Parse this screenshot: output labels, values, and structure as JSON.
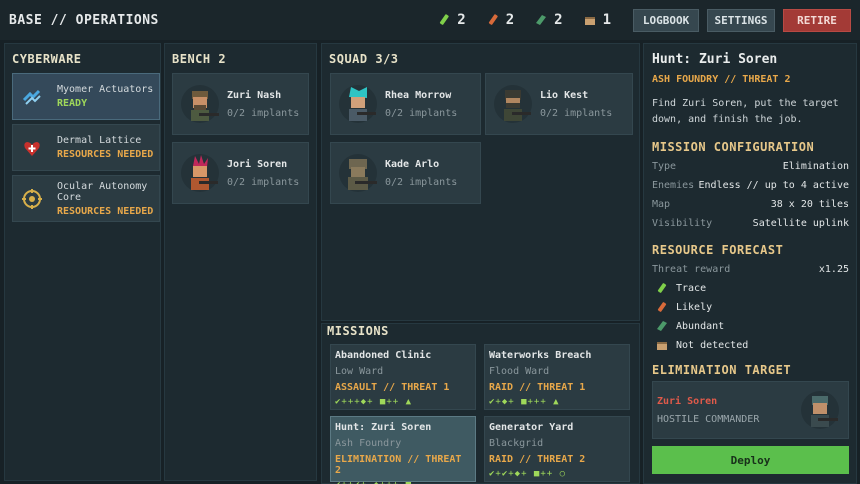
{
  "app": {
    "title": "BASE // OPERATIONS"
  },
  "resources": [
    {
      "icon": "trace-vial-icon",
      "color": "#7fcf4a",
      "count": "2"
    },
    {
      "icon": "likely-vial-icon",
      "color": "#d86a3a",
      "count": "2"
    },
    {
      "icon": "abundant-chip-icon",
      "color": "#4c9a6a",
      "count": "2"
    },
    {
      "icon": "not-detected-crate-icon",
      "color": "#c9a070",
      "count": "1"
    }
  ],
  "toolbar": {
    "logbook": "LOGBOOK",
    "settings": "SETTINGS",
    "retire": "RETIRE"
  },
  "cyberware": {
    "title": "CYBERWARE",
    "items": [
      {
        "name": "Myomer Actuators",
        "status": "READY",
        "state": "ok",
        "icon": "actuator-icon"
      },
      {
        "name": "Dermal Lattice",
        "status": "RESOURCES NEEDED",
        "state": "warn",
        "icon": "heart-plus-icon"
      },
      {
        "name": "Ocular Autonomy Core",
        "status": "RESOURCES NEEDED",
        "state": "warn",
        "icon": "eye-target-icon"
      }
    ]
  },
  "bench": {
    "title": "BENCH  2",
    "crew": [
      {
        "name": "Zuri Nash",
        "implants": "0/2 implants"
      },
      {
        "name": "Jori Soren",
        "implants": "0/2 implants"
      }
    ]
  },
  "squad": {
    "title": "SQUAD  3/3",
    "crew": [
      {
        "name": "Rhea Morrow",
        "implants": "0/2 implants"
      },
      {
        "name": "Lio Kest",
        "implants": "0/2 implants"
      },
      {
        "name": "Kade Arlo",
        "implants": "0/2 implants"
      }
    ]
  },
  "missions": {
    "title": "MISSIONS",
    "items": [
      {
        "name": "Abandoned Clinic",
        "location": "Low Ward",
        "type": "ASSAULT  //  THREAT 1",
        "loot": "✔+++◆+ ■++ ▲"
      },
      {
        "name": "Waterworks Breach",
        "location": "Flood Ward",
        "type": "RAID  //  THREAT 1",
        "loot": "✔+◆+ ■+++ ▲"
      },
      {
        "name": "Hunt: Zuri Soren",
        "location": "Ash Foundry",
        "type": "ELIMINATION  //  THREAT 2",
        "loot": "✔++✔+ ◆+++ ■"
      },
      {
        "name": "Generator Yard",
        "location": "Blackgrid",
        "type": "RAID  //  THREAT 2",
        "loot": "✔+✔+◆+ ■++ ○"
      }
    ]
  },
  "detail": {
    "title": "Hunt: Zuri Soren",
    "subtitle": "ASH FOUNDRY  //  THREAT 2",
    "description": "Find Zuri Soren, put the target down, and finish the job.",
    "config_title": "MISSION CONFIGURATION",
    "config": [
      {
        "k": "Type",
        "v": "Elimination"
      },
      {
        "k": "Enemies",
        "v": "Endless // up to 4 active"
      },
      {
        "k": "Map",
        "v": "38 x 20 tiles"
      },
      {
        "k": "Visibility",
        "v": "Satellite uplink"
      }
    ],
    "forecast_title": "RESOURCE FORECAST",
    "threat_reward_label": "Threat reward",
    "threat_reward_value": "x1.25",
    "legend": [
      "Trace",
      "Likely",
      "Abundant",
      "Not detected"
    ],
    "target_title": "ELIMINATION TARGET",
    "target_name": "Zuri Soren",
    "target_role": "HOSTILE COMMANDER",
    "deploy": "Deploy"
  }
}
